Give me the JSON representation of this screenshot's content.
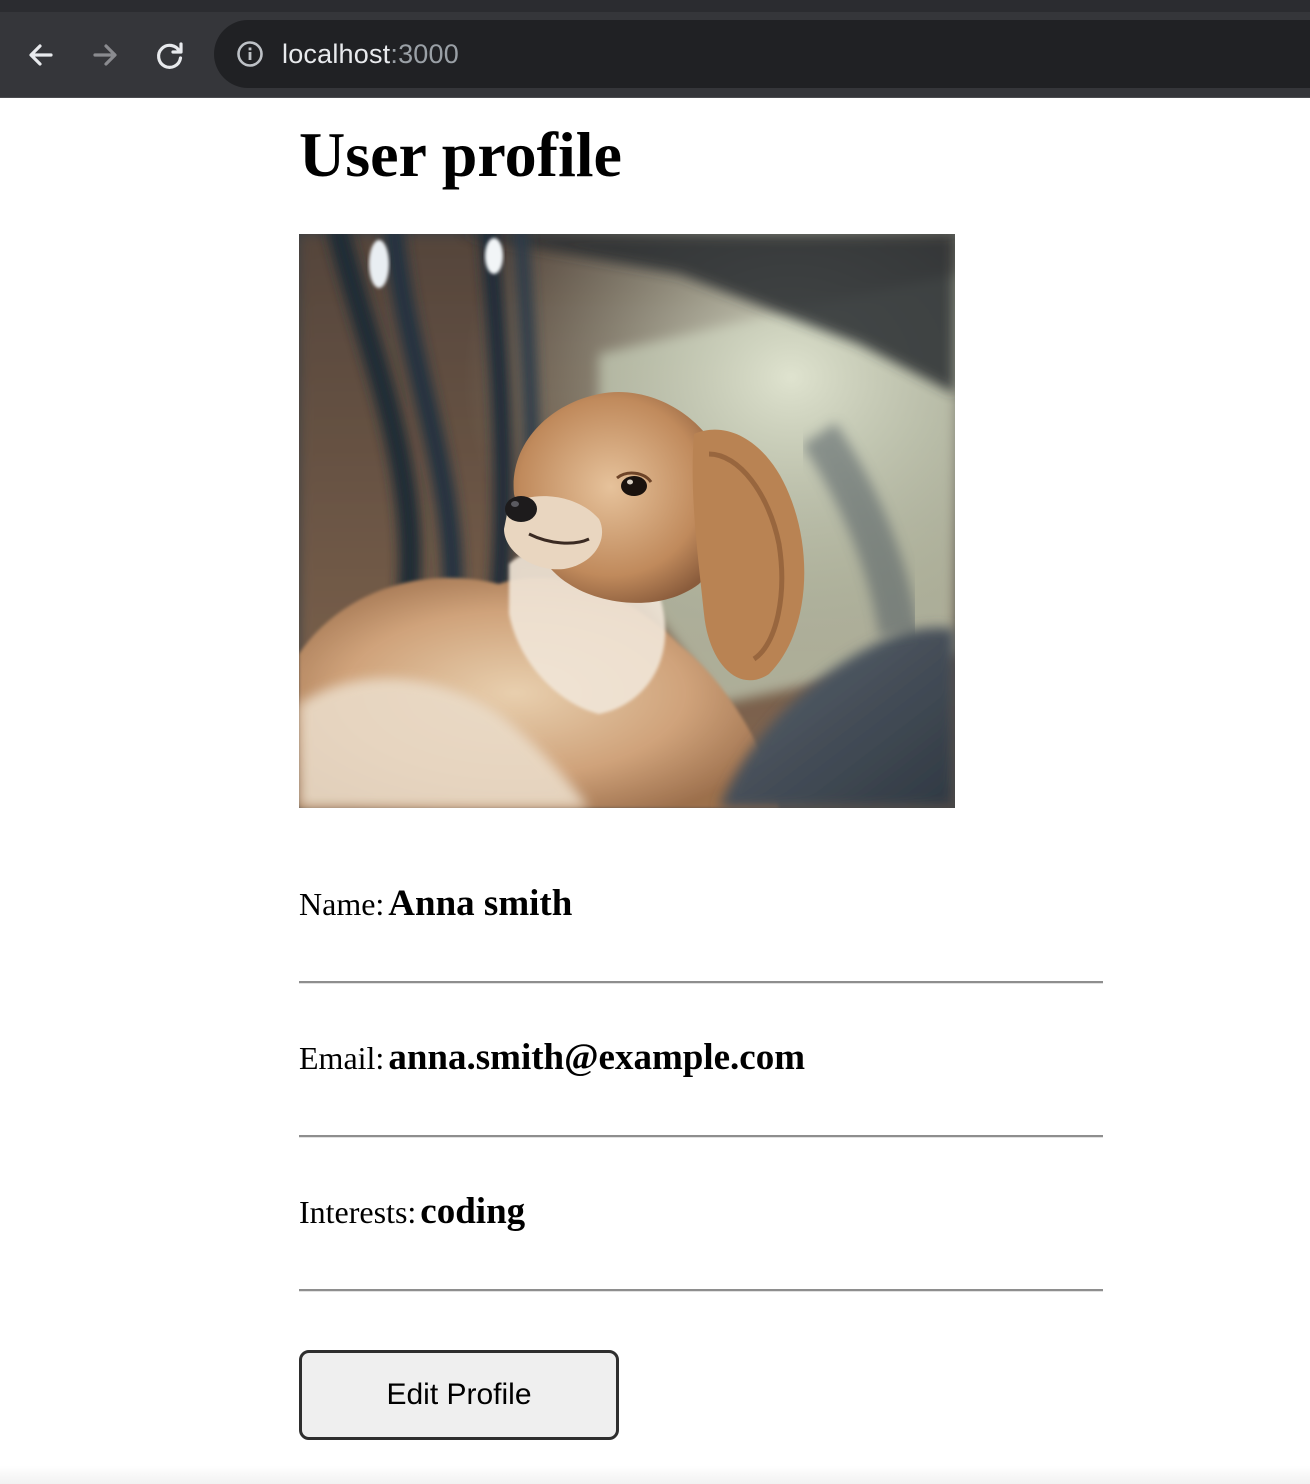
{
  "browser": {
    "url_host": "localhost",
    "url_port": ":3000",
    "icons": {
      "back": "arrow-left-icon",
      "forward": "arrow-right-icon",
      "reload": "reload-icon",
      "site_info": "info-circle-icon"
    }
  },
  "page": {
    "title": "User profile",
    "photo": {
      "subject": "dog",
      "alt": "Profile photo of a dog"
    },
    "fields": [
      {
        "label": "Name:",
        "value": "Anna smith"
      },
      {
        "label": "Email:",
        "value": "anna.smith@example.com"
      },
      {
        "label": "Interests:",
        "value": "coding"
      }
    ],
    "edit_button_label": "Edit Profile"
  },
  "colors": {
    "toolbar": "#35363a",
    "omnibox": "#202124",
    "url_text": "#e8eaed",
    "url_port": "#9aa0a6",
    "button_bg": "#efefef",
    "button_border": "#2e2e2e"
  }
}
